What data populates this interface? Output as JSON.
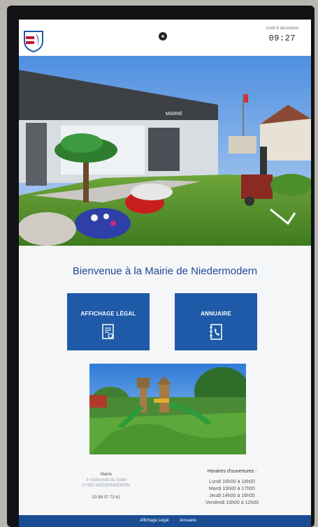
{
  "header": {
    "date": "lundi 8 décembre",
    "time": "09:27"
  },
  "main": {
    "welcome": "Bienvenue à la Mairie de Niedermodern",
    "building_sign": "MAIRIE",
    "tiles": [
      {
        "label": "AFFICHAGE LÉGAL",
        "icon": "certificate-document-icon"
      },
      {
        "label": "ANNUAIRE",
        "icon": "phone-book-icon"
      }
    ]
  },
  "footer": {
    "contact": {
      "name": "Mairie",
      "street": "3 esplanade du stade",
      "city": "67350 NIEDERMODERN",
      "phone": "03 88 07 73 61"
    },
    "hours": {
      "title": "Horaires d'ouvertures :",
      "lines": [
        "Lundi 16h00 à 18h00",
        "Mardi 15h00 à 17h00",
        "Jeudi 14h00 à 16h00",
        "Vendredi 10h00 à 12h00"
      ]
    }
  },
  "bottom_nav": [
    {
      "label": "Affichage Légal"
    },
    {
      "label": "Annuaire"
    }
  ],
  "colors": {
    "accent": "#1e5aa8",
    "title": "#1f4a94",
    "nav": "#1a4d94"
  }
}
